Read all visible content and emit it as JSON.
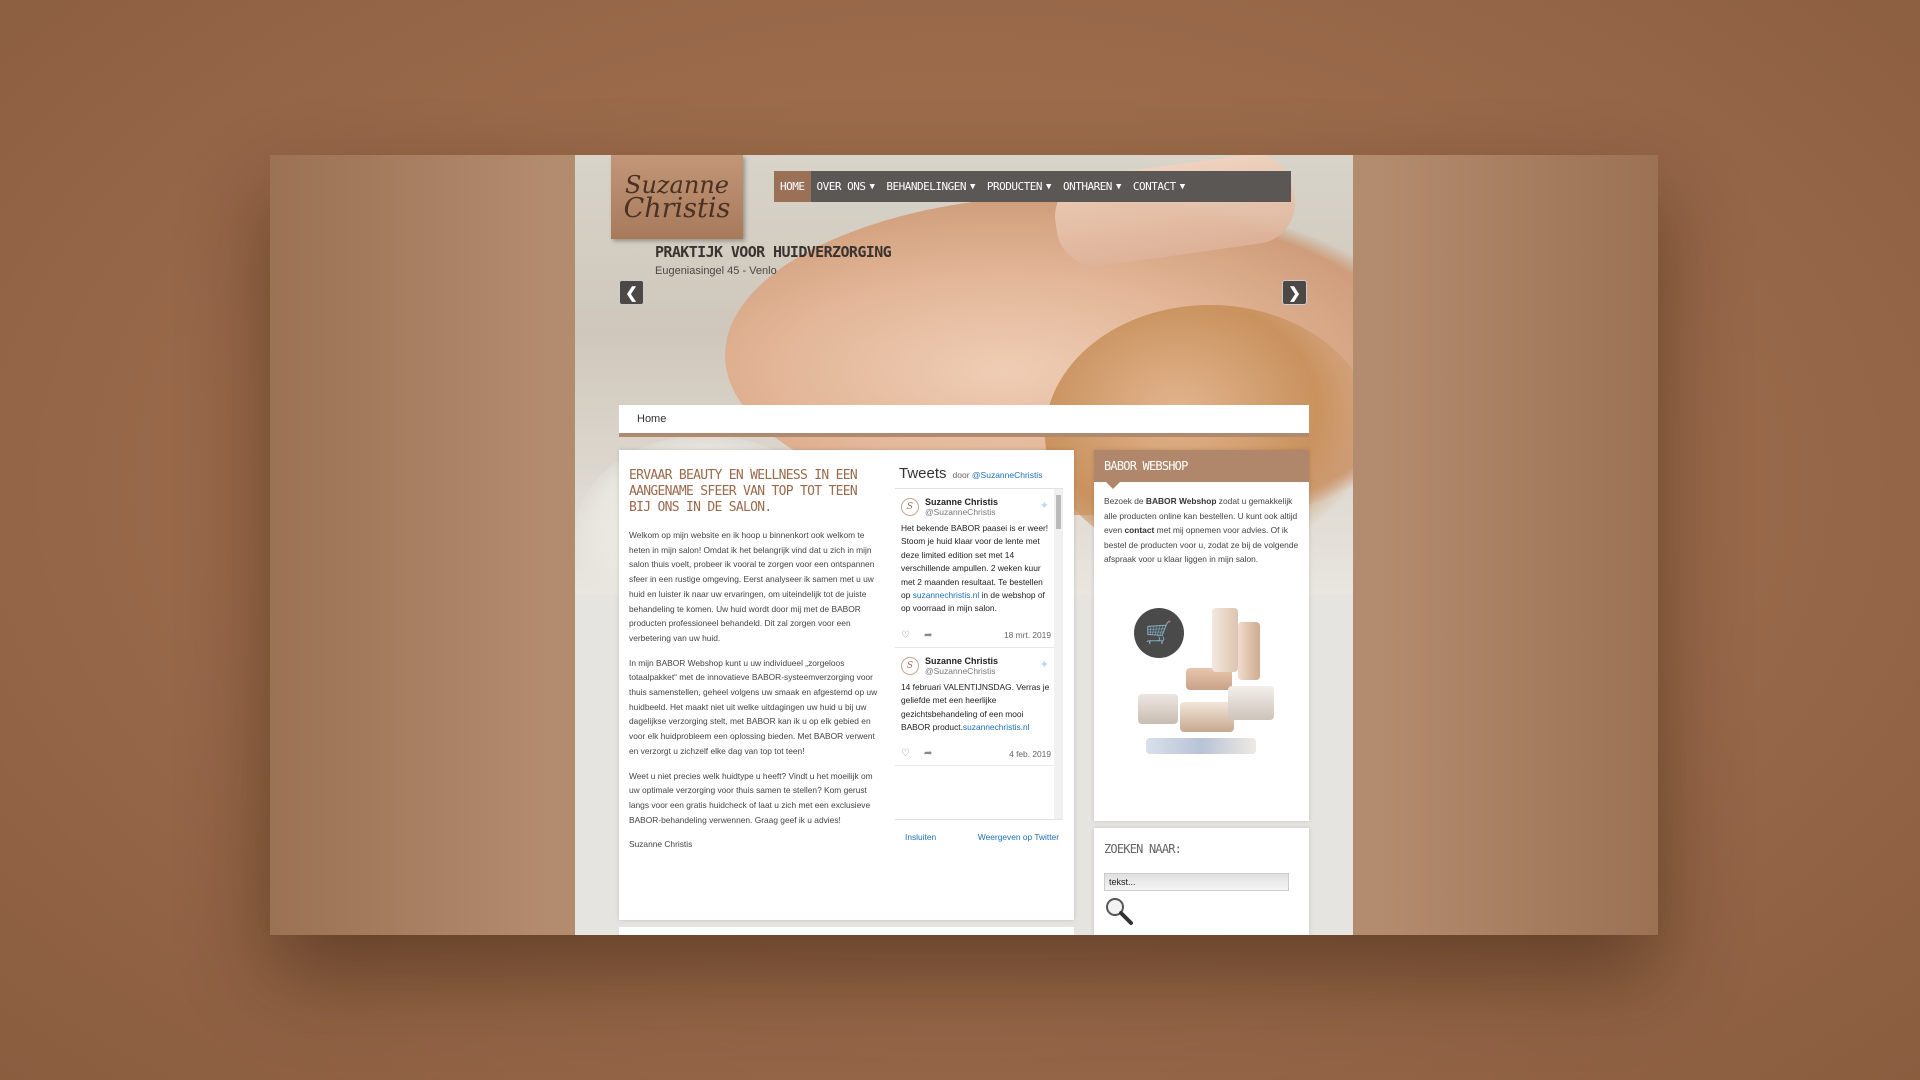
{
  "logo": {
    "line1": "Suzanne",
    "line2": "Christis"
  },
  "nav": [
    {
      "label": "HOME",
      "dropdown": false
    },
    {
      "label": "OVER ONS",
      "dropdown": true
    },
    {
      "label": "BEHANDELINGEN",
      "dropdown": true
    },
    {
      "label": "PRODUCTEN",
      "dropdown": true
    },
    {
      "label": "ONTHAREN",
      "dropdown": true
    },
    {
      "label": "CONTACT",
      "dropdown": true
    }
  ],
  "hero": {
    "tagline": "PRAKTIJK VOOR HUIDVERZORGING",
    "address": "Eugeniasingel 45 - Venlo"
  },
  "breadcrumb": {
    "label": "Home"
  },
  "article": {
    "title": "ERVAAR BEAUTY EN WELLNESS IN EEN AANGENAME SFEER VAN TOP TOT TEEN BIJ ONS IN DE SALON.",
    "p1": "Welkom op mijn website en ik hoop u binnenkort ook welkom te heten in mijn salon! Omdat ik het belangrijk vind dat u zich in mijn salon thuis voelt, probeer ik vooral te zorgen voor een ontspannen sfeer in een rustige omgeving. Eerst analyseer ik samen met u uw huid en luister ik naar uw ervaringen, om uiteindelijk tot de juiste behandeling te komen. Uw huid wordt door mij met de BABOR producten professioneel behandeld. Dit zal zorgen voor een verbetering van uw huid.",
    "p2": "In mijn BABOR Webshop kunt u uw individueel „zorgeloos totaalpakket“ met de innovatieve BABOR-systeemverzorging voor thuis samenstellen, geheel volgens uw smaak en afgestemd op uw huidbeeld. Het maakt niet uit welke uitdagingen uw huid u bij uw dagelijkse verzorging stelt, met BABOR kan ik u op elk gebied en voor elk huidprobleem een oplossing bieden. Met BABOR verwent en verzorgt u zichzelf elke dag van top tot teen!",
    "p3": "Weet u niet precies welk huidtype u heeft? Vindt u het moeilijk om uw optimale verzorging voor thuis samen te stellen? Kom gerust langs voor een gratis huidcheck of laat u zich met een exclusieve BABOR-behandeling verwennen. Graag geef ik u advies!",
    "signature": "Suzanne Christis"
  },
  "twitter": {
    "title": "Tweets",
    "by_prefix": "door",
    "handle": "@SuzanneChristis",
    "tweets": [
      {
        "name": "Suzanne Christis",
        "handle": "@SuzanneChristis",
        "text": "Het bekende BABOR paasei is er weer! Stoom je huid klaar voor de lente met deze limited edition set met 14 verschillende ampullen. 2 weken kuur met 2 maanden resultaat. Te bestellen op",
        "link": "suzannechristis.nl",
        "text_after": " in de webshop of op voorraad in mijn salon.",
        "date": "18 mrt. 2019"
      },
      {
        "name": "Suzanne Christis",
        "handle": "@SuzanneChristis",
        "text": "14 februari VALENTIJNSDAG. Verras je geliefde met een heerlijke gezichtsbehandeling of een mooi BABOR product.",
        "link": "suzannechristis.nl",
        "text_after": "",
        "date": "4 feb. 2019"
      }
    ],
    "embed_label": "Insluiten",
    "view_label": "Weergeven op Twitter"
  },
  "webshop": {
    "title": "BABOR WEBSHOP",
    "t1": "Bezoek de ",
    "t1b": "BABOR Webshop",
    "t2": " zodat u gemakkelijk alle producten online kan bestellen. U kunt ook altijd even ",
    "t2b": "contact",
    "t3": " met mij opnemen voor advies. Of ik bestel de producten voor u, zodat ze bij de volgende afspraak voor u klaar liggen in mijn salon."
  },
  "search": {
    "title": "ZOEKEN NAAR:",
    "value": "tekst..."
  },
  "colors": {
    "accent": "#b1876b",
    "nav": "#5a5755",
    "link": "#1b6fb5",
    "background": "#9a6a48"
  }
}
